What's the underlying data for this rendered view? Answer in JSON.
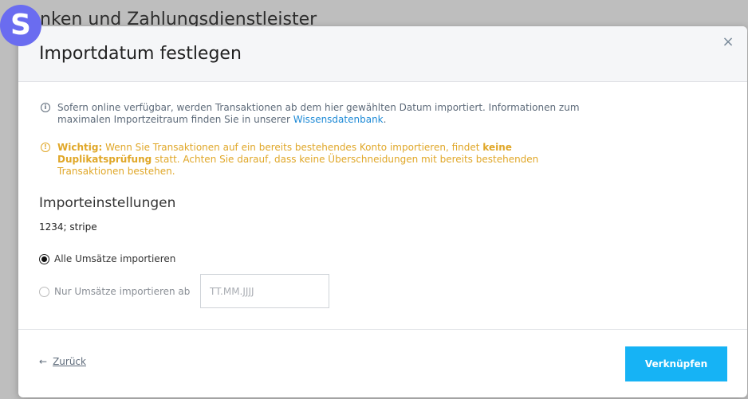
{
  "background": {
    "title": "nken und Zahlungsdienstleister",
    "logo_letter": "S"
  },
  "modal": {
    "title": "Importdatum festlegen",
    "close_symbol": "×",
    "info": {
      "text": "Sofern online verfügbar, werden Transaktionen ab dem hier gewählten Datum importiert. Informationen zum maximalen Importzeitraum finden Sie in unserer",
      "link_text": "Wissensdatenbank",
      "suffix": "."
    },
    "warning": {
      "bold_prefix": "Wichtig:",
      "text_1": " Wenn Sie Transaktionen auf ein bereits bestehendes Konto importieren, findet ",
      "bold_middle": "keine Duplikatsprüfung",
      "text_2": " statt. Achten Sie darauf, dass keine Überschneidungen mit bereits bestehenden Transaktionen bestehen."
    },
    "section_title": "Importeinstellungen",
    "account_name": "1234; stripe",
    "options": [
      {
        "label": "Alle Umsätze importieren",
        "checked": true
      },
      {
        "label": "Nur Umsätze importieren ab",
        "checked": false
      }
    ],
    "date_placeholder": "TT.MM.JJJJ",
    "back_arrow": "←",
    "back_label": "Zurück",
    "primary_button": "Verknüpfen"
  },
  "colors": {
    "accent": "#16b3f5",
    "warning": "#e0a728",
    "link": "#1e8ad6",
    "logo": "#6a6cf0"
  },
  "icons": [
    "info-icon",
    "warning-icon",
    "close-icon",
    "arrow-left-icon"
  ]
}
